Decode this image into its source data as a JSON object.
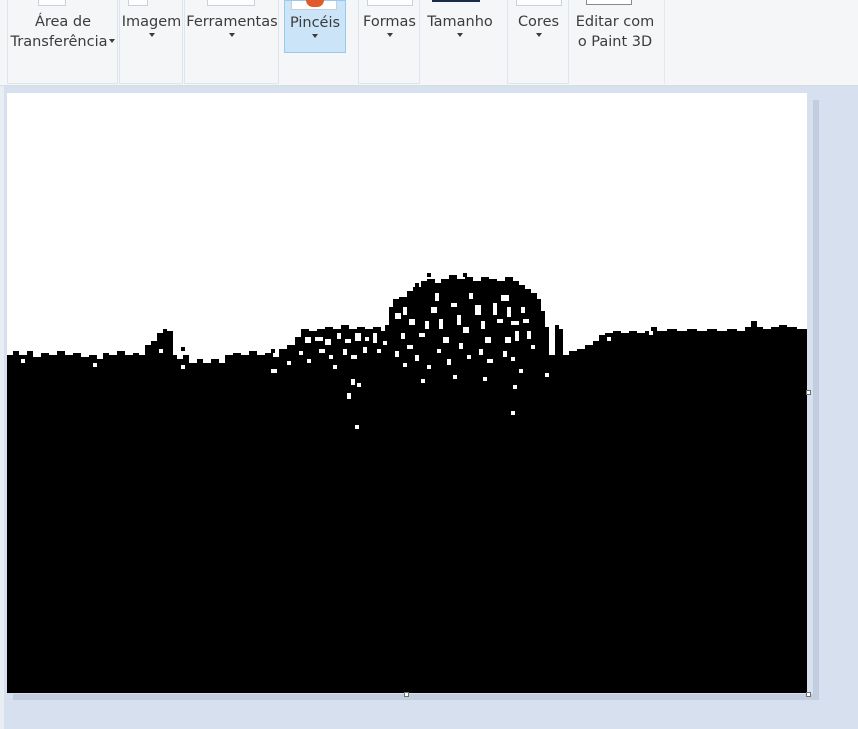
{
  "ribbon": {
    "clipboard": {
      "line1": "Área de",
      "line2": "Transferência"
    },
    "image": {
      "label": "Imagem"
    },
    "tools": {
      "label": "Ferramentas"
    },
    "brushes": {
      "label": "Pincéis"
    },
    "shapes": {
      "label": "Formas"
    },
    "size": {
      "label": "Tamanho"
    },
    "colors": {
      "label": "Cores"
    },
    "paint3d": {
      "line1": "Editar com",
      "line2": "o Paint 3D"
    }
  },
  "canvas": {
    "content": "black-and-white thresholded landscape image"
  },
  "colors": {
    "ribbon_bg": "#f5f6f7",
    "workspace_bg": "#d7e0ee",
    "active_button_bg": "#cce4f7",
    "active_button_border": "#99c9ef"
  }
}
